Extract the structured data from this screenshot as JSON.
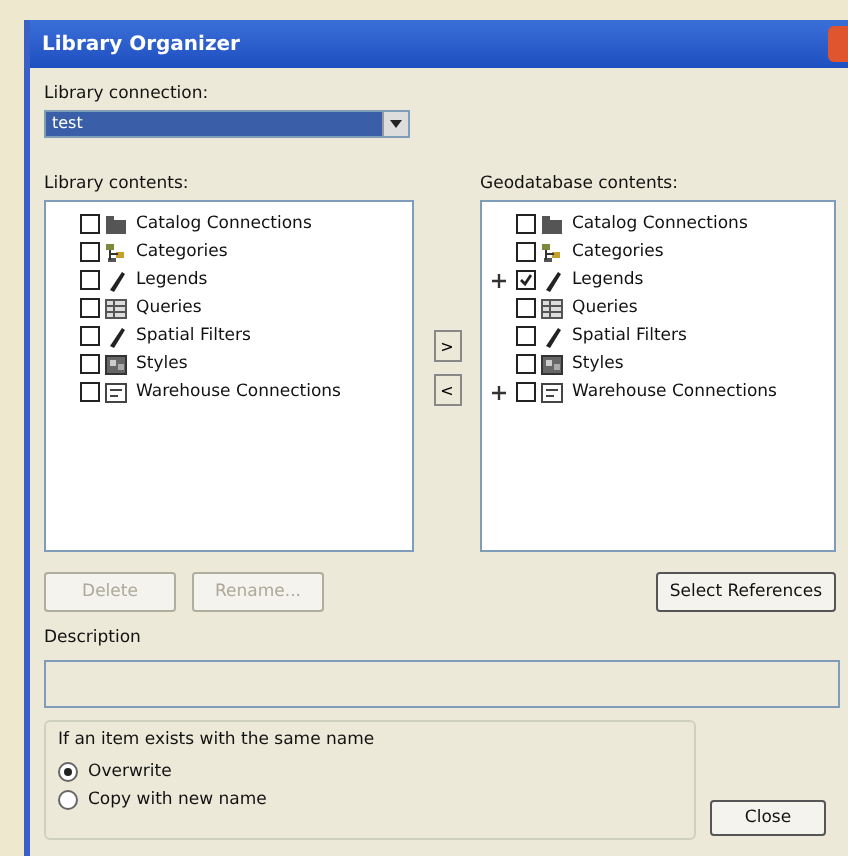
{
  "window": {
    "title": "Library Organizer"
  },
  "library_connection": {
    "label": "Library connection:",
    "value": "test"
  },
  "library_contents": {
    "label": "Library contents:",
    "items": [
      {
        "label": "Catalog Connections",
        "checked": false,
        "expandable": false
      },
      {
        "label": "Categories",
        "checked": false,
        "expandable": false
      },
      {
        "label": "Legends",
        "checked": false,
        "expandable": false
      },
      {
        "label": "Queries",
        "checked": false,
        "expandable": false
      },
      {
        "label": "Spatial Filters",
        "checked": false,
        "expandable": false
      },
      {
        "label": "Styles",
        "checked": false,
        "expandable": false
      },
      {
        "label": "Warehouse Connections",
        "checked": false,
        "expandable": false
      }
    ]
  },
  "transfer_buttons": [
    {
      "label": ">"
    },
    {
      "label": "<"
    }
  ],
  "geodatabase_contents": {
    "label": "Geodatabase contents:",
    "items": [
      {
        "label": "Catalog Connections",
        "checked": false,
        "expandable": false
      },
      {
        "label": "Categories",
        "checked": false,
        "expandable": false
      },
      {
        "label": "Legends",
        "checked": true,
        "expandable": true
      },
      {
        "label": "Queries",
        "checked": false,
        "expandable": false
      },
      {
        "label": "Spatial Filters",
        "checked": false,
        "expandable": false
      },
      {
        "label": "Styles",
        "checked": false,
        "expandable": false
      },
      {
        "label": "Warehouse Connections",
        "checked": false,
        "expandable": true
      }
    ]
  },
  "buttons": [
    {
      "label": "Delete",
      "disabled": true
    },
    {
      "label": "Rename...",
      "disabled": true
    }
  ],
  "select_references": {
    "label": "Select References"
  },
  "description": {
    "label": "Description"
  },
  "duplicate_options": {
    "label": "If an item exists with the same name",
    "options": [
      {
        "label": "Overwrite",
        "selected": true
      },
      {
        "label": "Copy with new name",
        "selected": false
      }
    ]
  },
  "close_button": {
    "label": "Close"
  }
}
